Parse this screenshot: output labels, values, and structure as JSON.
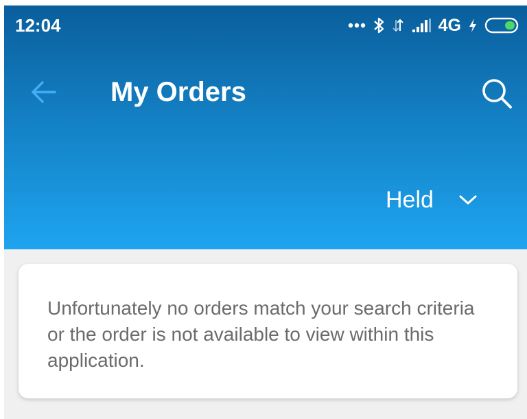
{
  "status_bar": {
    "time": "12:04",
    "network": "4G",
    "icons": [
      "more-dots-icon",
      "bluetooth-icon",
      "data-arrows-icon",
      "signal-icon",
      "charging-icon",
      "battery-icon"
    ]
  },
  "toolbar": {
    "back_icon": "arrow-left-icon",
    "title": "My Orders",
    "search_icon": "search-icon"
  },
  "filter": {
    "selected": "Held",
    "icon": "chevron-down-icon"
  },
  "empty_state": {
    "message": "Unfortunately no orders match your search criteria or the order is not available to view within this application."
  },
  "colors": {
    "header_top": "#0a5e9c",
    "header_bottom": "#1ea4f0",
    "back_arrow": "#42aef6",
    "message_text": "#6b6b6b",
    "content_bg": "#f0f0f0"
  }
}
